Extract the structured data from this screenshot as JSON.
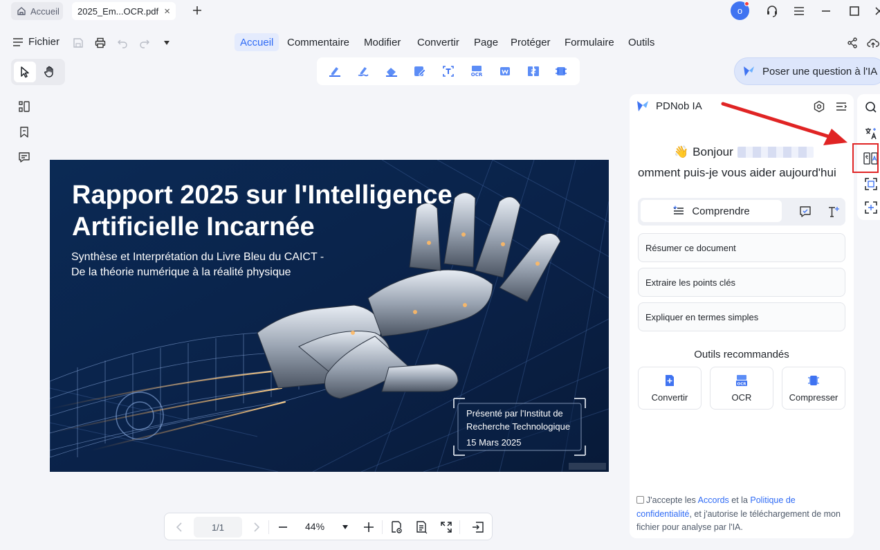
{
  "tabs": {
    "home_label": "Accueil",
    "doc_label": "2025_Em...OCR.pdf",
    "close_glyph": "×",
    "new_glyph": "+"
  },
  "user": {
    "avatar_initial": "o"
  },
  "menu": {
    "file_label": "Fichier",
    "items": [
      "Accueil",
      "Commentaire",
      "Modifier",
      "Convertir",
      "Page",
      "Protéger",
      "Formulaire",
      "Outils"
    ]
  },
  "toolbar": {
    "ask_ai_label": "Poser une question à l'IA",
    "tools": [
      "highlight-icon",
      "underline-icon",
      "eraser-icon",
      "edit-text-icon",
      "text-box-icon",
      "ocr-icon",
      "convert-word-icon",
      "compare-icon",
      "compress-icon"
    ],
    "ocr_badge": "OCR"
  },
  "document": {
    "title_line1": "Rapport 2025 sur l'Intelligence",
    "title_line2": "Artificielle Incarnée",
    "subtitle_line1": "Synthèse et Interprétation du Livre Bleu du CAICT -",
    "subtitle_line2": "De la théorie numérique à la réalité physique",
    "presented_line1": "Présenté par l'Institut de",
    "presented_line2": "Recherche Technologique",
    "presented_date": "15 Mars 2025"
  },
  "bottombar": {
    "page_indicator": "1/1",
    "zoom_level": "44%"
  },
  "ai_panel": {
    "title": "PDNob IA",
    "greeting": "Bonjour",
    "wave_emoji": "👋",
    "help_text": "omment puis-je vous aider aujourd'hui",
    "tab_understand": "Comprendre",
    "suggestions": [
      "Résumer ce document",
      "Extraire les points clés",
      "Expliquer en termes simples"
    ],
    "recommended_title": "Outils recommandés",
    "tools": [
      "Convertir",
      "OCR",
      "Compresser"
    ],
    "consent": {
      "prefix": "J'accepte les ",
      "link1": "Accords",
      "middle": " et la ",
      "link2": "Politique de confidentialité",
      "suffix": ", et j'autorise le téléchargement de mon fichier pour analyse par l'IA."
    }
  },
  "colors": {
    "accent": "#2f6bf5",
    "highlight_box": "#e02424",
    "doc_background": "#0a2247"
  }
}
